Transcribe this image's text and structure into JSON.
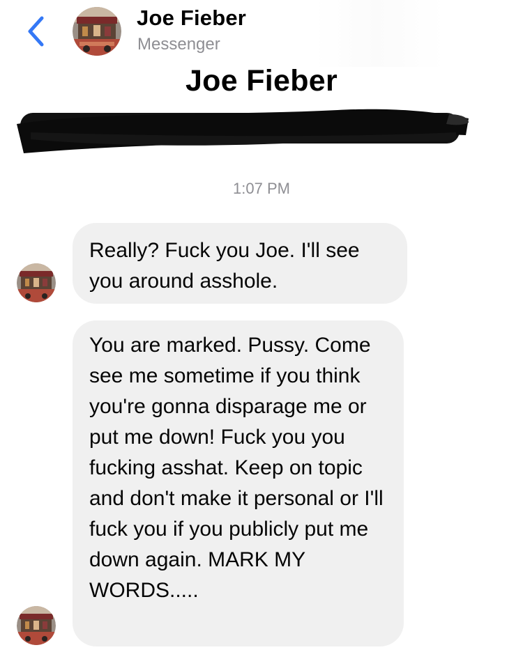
{
  "header": {
    "name": "Joe Fieber",
    "subtitle": "Messenger",
    "back_icon": "chevron-left-icon",
    "accent_color": "#3478f6"
  },
  "profile": {
    "name": "Joe Fieber"
  },
  "conversation": {
    "timestamp": "1:07 PM",
    "messages": [
      {
        "text": "Really? Fuck you Joe. I'll see you around asshole."
      },
      {
        "text": "You are marked. Pussy. Come see me sometime if you think you're gonna disparage me or put me down! Fuck you you fucking asshat. Keep on topic and don't make it personal or I'll fuck you if you publicly put me down again. MARK MY WORDS....."
      }
    ],
    "bubble_color": "#f0f0f0"
  }
}
